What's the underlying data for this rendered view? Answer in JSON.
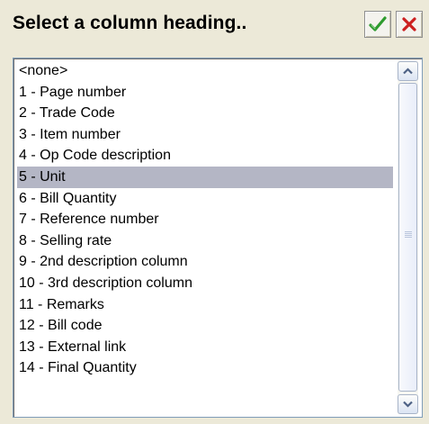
{
  "dialog": {
    "title": "Select a column heading.."
  },
  "buttons": {
    "ok_icon": "green-checkmark-icon",
    "cancel_icon": "red-x-icon"
  },
  "colors": {
    "selected_row": "#b4b6c5",
    "ok_green": "#2e9b2e",
    "cancel_red": "#cc2020"
  },
  "list": {
    "selected_index": 5,
    "items": [
      {
        "label": "<none>"
      },
      {
        "label": "1 - Page number"
      },
      {
        "label": "2 - Trade Code"
      },
      {
        "label": "3 - Item number"
      },
      {
        "label": "4 - Op Code description"
      },
      {
        "label": "5 - Unit"
      },
      {
        "label": "6 - Bill Quantity"
      },
      {
        "label": "7 - Reference number"
      },
      {
        "label": "8 - Selling rate"
      },
      {
        "label": "9 - 2nd description column"
      },
      {
        "label": "10 - 3rd description column"
      },
      {
        "label": "11 - Remarks"
      },
      {
        "label": "12 - Bill code"
      },
      {
        "label": "13 - External link"
      },
      {
        "label": "14 - Final Quantity"
      }
    ]
  }
}
